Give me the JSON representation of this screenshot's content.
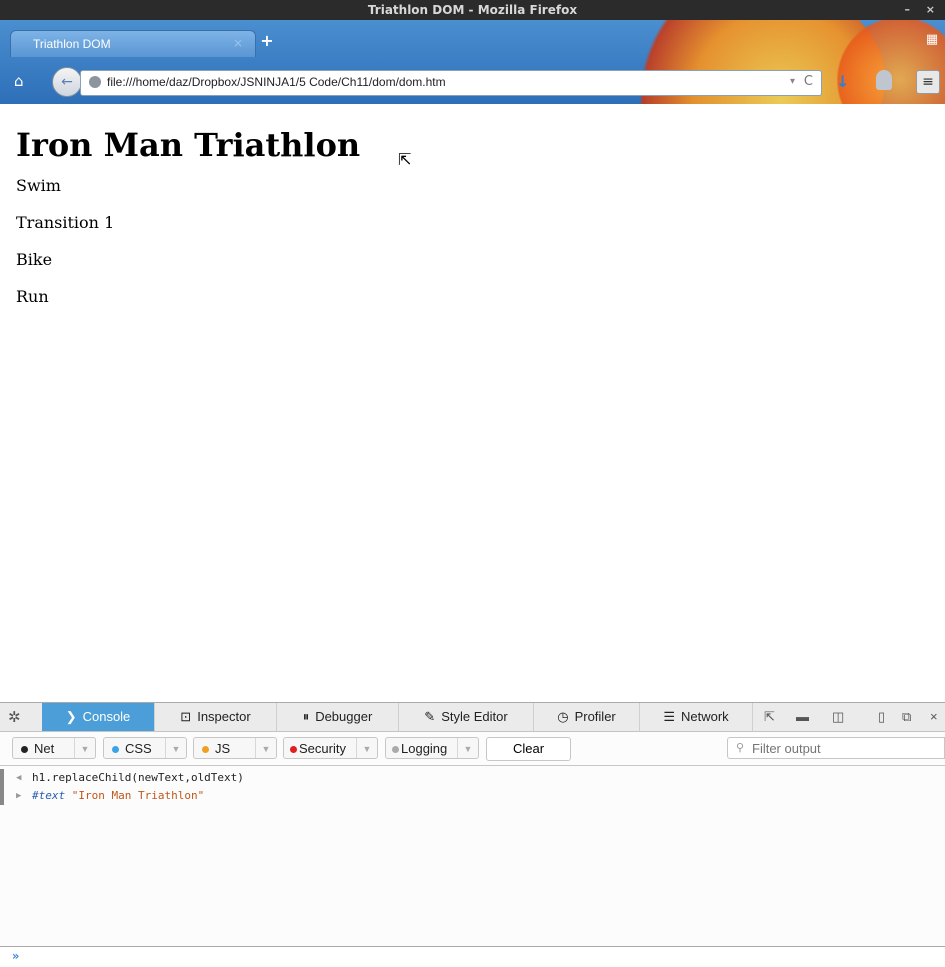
{
  "window": {
    "title": "Triathlon DOM - Mozilla Firefox"
  },
  "tab": {
    "label": "Triathlon DOM",
    "close": "×",
    "new_tab": "+"
  },
  "nav": {
    "url": "file:///home/daz/Dropbox/JSNINJA1/5 Code/Ch11/dom/dom.htm",
    "home": "⌂",
    "back": "←",
    "reload": "C",
    "dropdown": "▾",
    "menu": "≡"
  },
  "page": {
    "heading": "Iron Man Triathlon",
    "items": [
      "Swim",
      "Transition 1",
      "Bike",
      "Run"
    ]
  },
  "devtools": {
    "tabs": [
      {
        "label": "Console",
        "icon": "console-icon",
        "active": true
      },
      {
        "label": "Inspector",
        "icon": "inspector-icon"
      },
      {
        "label": "Debugger",
        "icon": "debugger-icon"
      },
      {
        "label": "Style Editor",
        "icon": "style-editor-icon"
      },
      {
        "label": "Profiler",
        "icon": "profiler-icon"
      },
      {
        "label": "Network",
        "icon": "network-icon"
      }
    ],
    "filters": [
      {
        "label": "Net",
        "color": "#222222"
      },
      {
        "label": "CSS",
        "color": "#3ba4e6"
      },
      {
        "label": "JS",
        "color": "#f0a020"
      },
      {
        "label": "Security",
        "color": "#e02020"
      },
      {
        "label": "Logging",
        "color": "#aaaaaa"
      }
    ],
    "clear": "Clear",
    "filter_placeholder": "Filter output",
    "output": [
      {
        "direction": "input",
        "text": "h1.replaceChild(newText,oldText)"
      },
      {
        "direction": "output",
        "type": "#text",
        "value": "\"Iron Man Triathlon\""
      }
    ],
    "prompt": "»"
  }
}
